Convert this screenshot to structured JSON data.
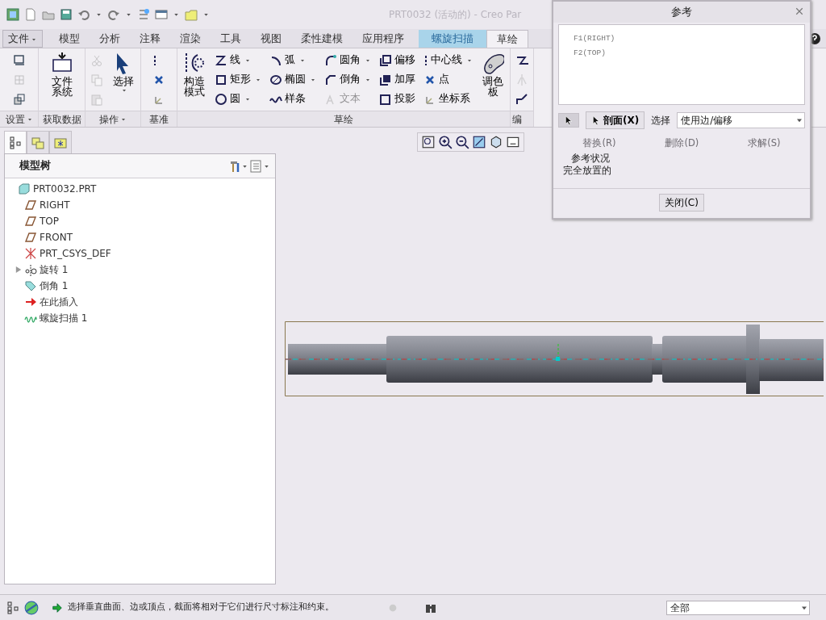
{
  "window": {
    "title": "PRT0032 (活动的) - Creo Par"
  },
  "ribbon_tabs": [
    {
      "label": "文件",
      "kind": "menu",
      "selected": false
    },
    {
      "label": "模型",
      "kind": "tab",
      "selected": false
    },
    {
      "label": "分析",
      "kind": "tab",
      "selected": false
    },
    {
      "label": "注释",
      "kind": "tab",
      "selected": false
    },
    {
      "label": "渲染",
      "kind": "tab",
      "selected": false
    },
    {
      "label": "工具",
      "kind": "tab",
      "selected": false
    },
    {
      "label": "视图",
      "kind": "tab",
      "selected": false
    },
    {
      "label": "柔性建模",
      "kind": "tab",
      "selected": false
    },
    {
      "label": "应用程序",
      "kind": "tab",
      "selected": false
    },
    {
      "label": "螺旋扫描",
      "kind": "feature",
      "selected": false
    },
    {
      "label": "草绘",
      "kind": "tab",
      "selected": true
    }
  ],
  "ribbon_groups": [
    {
      "label": "设置",
      "dropdown": true,
      "columns": [
        {
          "kind": "stack",
          "items": [
            {
              "disabled": false
            },
            {
              "disabled": true
            },
            {
              "disabled": false
            }
          ]
        }
      ]
    },
    {
      "label": "获取数据",
      "dropdown": false,
      "columns": [
        {
          "kind": "large",
          "label": "文件系统",
          "dropdown": false,
          "disabled": false
        }
      ]
    },
    {
      "label": "操作",
      "dropdown": true,
      "columns": [
        {
          "kind": "stack",
          "items": [
            {
              "disabled": true
            },
            {
              "disabled": true
            },
            {
              "disabled": true
            }
          ]
        },
        {
          "kind": "large",
          "label": "选择",
          "dropdown": true,
          "disabled": false
        }
      ]
    },
    {
      "label": "基准",
      "dropdown": false,
      "columns": [
        {
          "kind": "stack",
          "items": [
            {
              "disabled": false
            },
            {
              "disabled": false
            },
            {
              "disabled": false
            }
          ]
        }
      ]
    },
    {
      "label": "草绘",
      "dropdown": false,
      "columns": [
        {
          "kind": "large",
          "label": "构造模式",
          "dropdown": false,
          "disabled": false
        },
        {
          "kind": "stack",
          "items": [
            {
              "label": "线",
              "dropdown": true,
              "disabled": false
            },
            {
              "label": "矩形",
              "dropdown": true,
              "disabled": false
            },
            {
              "label": "圆",
              "dropdown": true,
              "disabled": false
            }
          ]
        },
        {
          "kind": "stack",
          "items": [
            {
              "label": "弧",
              "dropdown": true,
              "disabled": false
            },
            {
              "label": "椭圆",
              "dropdown": true,
              "disabled": false
            },
            {
              "label": "样条",
              "dropdown": false,
              "disabled": false
            }
          ]
        },
        {
          "kind": "stack",
          "items": [
            {
              "label": "圆角",
              "dropdown": true,
              "disabled": false
            },
            {
              "label": "倒角",
              "dropdown": true,
              "disabled": false
            },
            {
              "label": "文本",
              "dropdown": false,
              "disabled": true
            }
          ]
        },
        {
          "kind": "stack",
          "items": [
            {
              "label": "偏移",
              "dropdown": false,
              "disabled": false
            },
            {
              "label": "加厚",
              "dropdown": false,
              "disabled": false
            },
            {
              "label": "投影",
              "dropdown": false,
              "disabled": false
            }
          ]
        },
        {
          "kind": "stack",
          "items": [
            {
              "label": "中心线",
              "dropdown": true,
              "disabled": false
            },
            {
              "label": "点",
              "dropdown": false,
              "disabled": false
            },
            {
              "label": "坐标系",
              "dropdown": false,
              "disabled": false
            }
          ]
        },
        {
          "kind": "large",
          "label": "调色板",
          "dropdown": false,
          "disabled": false
        }
      ]
    },
    {
      "label": "编",
      "dropdown": false,
      "columns": [
        {
          "kind": "stack",
          "items": [
            {
              "disabled": false
            },
            {
              "disabled": true
            },
            {
              "disabled": false
            }
          ]
        }
      ]
    }
  ],
  "navigator_tabs": [
    {
      "selected": true
    },
    {
      "selected": false
    },
    {
      "selected": false
    }
  ],
  "model_tree": {
    "title": "模型树",
    "items": [
      {
        "label": "PRT0032.PRT",
        "expandable": false
      },
      {
        "label": "RIGHT",
        "expandable": false
      },
      {
        "label": "TOP",
        "expandable": false
      },
      {
        "label": "FRONT",
        "expandable": false
      },
      {
        "label": "PRT_CSYS_DEF",
        "expandable": false
      },
      {
        "label": "旋转 1",
        "expandable": true
      },
      {
        "label": "倒角 1",
        "expandable": false
      },
      {
        "label": "在此插入",
        "expandable": false
      },
      {
        "label": "螺旋扫描 1",
        "expandable": false
      }
    ]
  },
  "references_dialog": {
    "title": "参考",
    "references": [
      "F1(RIGHT)",
      "F2(TOP)"
    ],
    "section_button": "剖面(X)",
    "select_label": "选择",
    "select_value": "使用边/偏移",
    "actions": [
      {
        "label": "替换(R)",
        "disabled": true
      },
      {
        "label": "删除(D)",
        "disabled": true
      },
      {
        "label": "求解(S)",
        "disabled": true
      }
    ],
    "status_label": "参考状况",
    "status_value": "完全放置的",
    "close_button": "关闭(C)"
  },
  "status_bar": {
    "message": "选择垂直曲面、边或顶点，截面将相对于它们进行尺寸标注和约束。",
    "filter": "全部"
  }
}
